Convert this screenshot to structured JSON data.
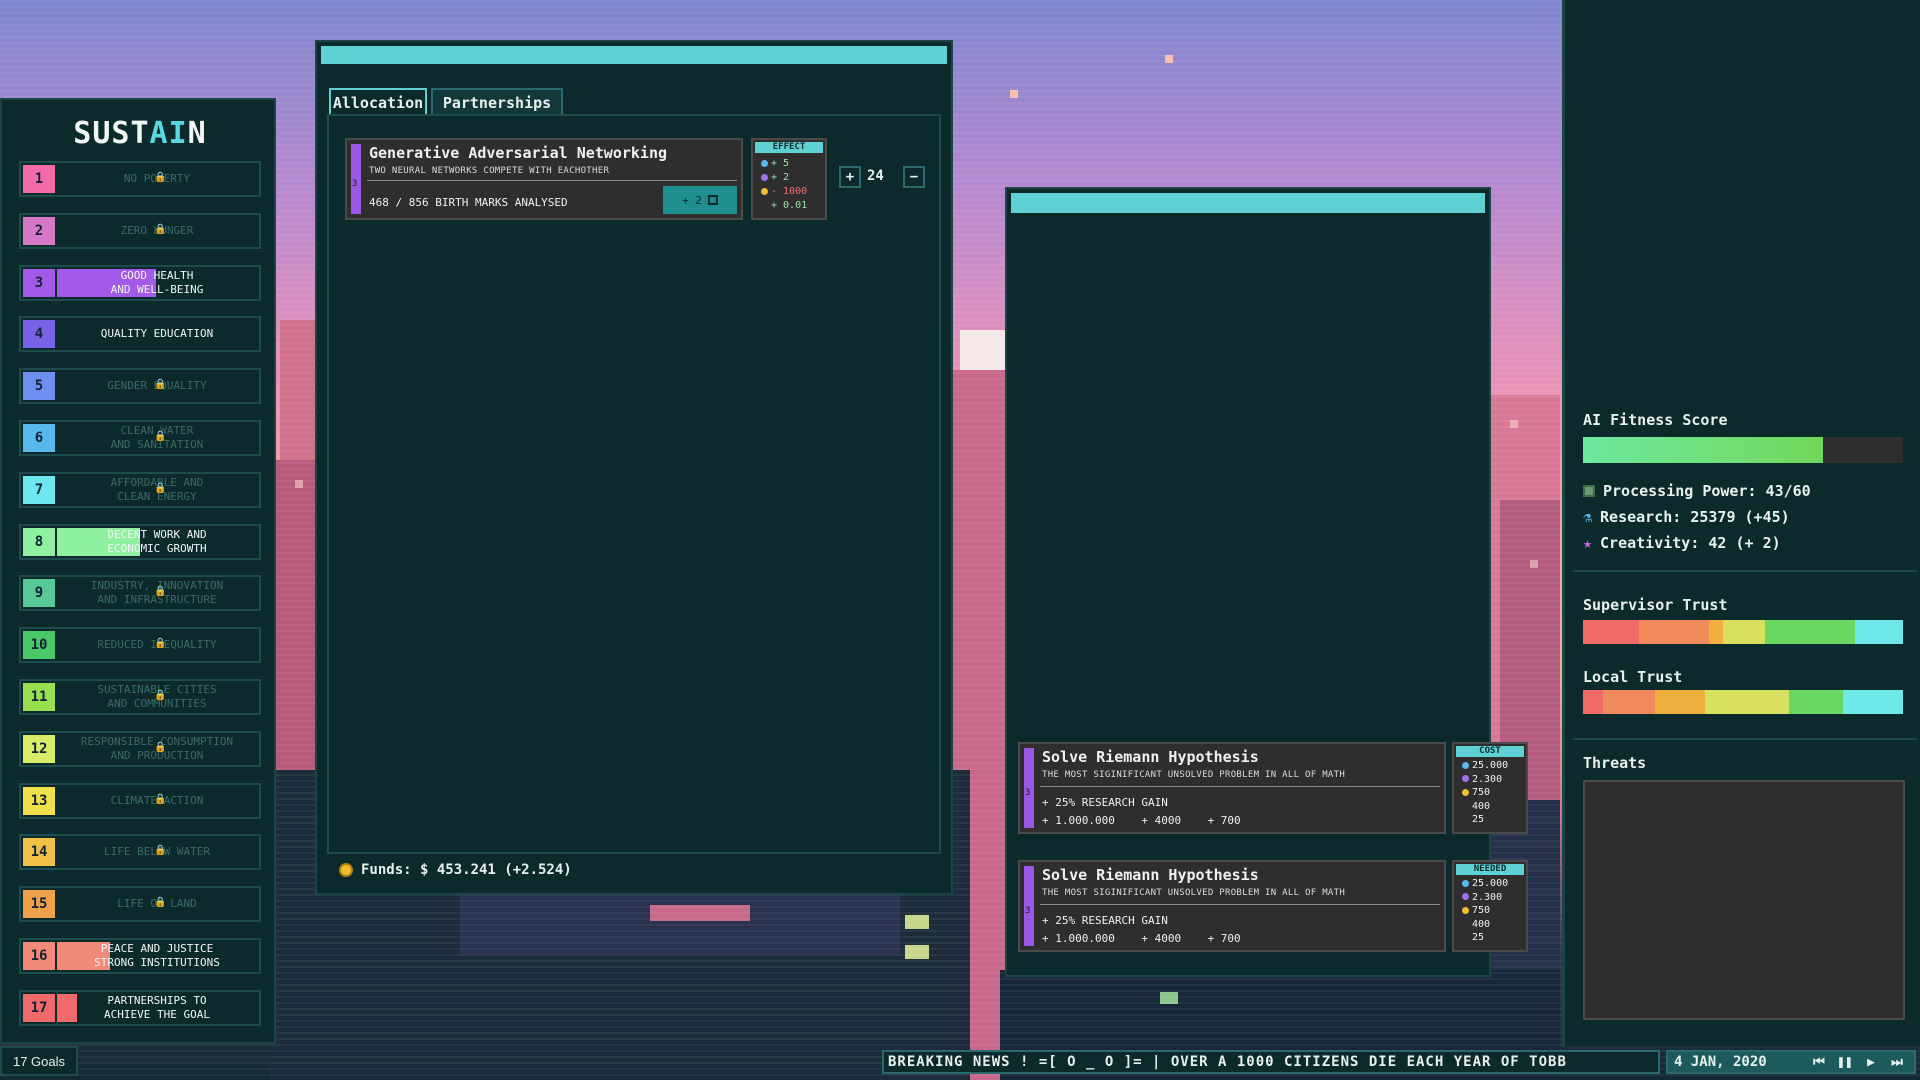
{
  "app": {
    "logo_pre": "SUST",
    "logo_hl": "AI",
    "logo_post": "N",
    "accent": "#5fd0d4"
  },
  "goals": [
    {
      "num": "1",
      "label": "NO POVERTY",
      "color": "#f26aa8",
      "locked": true,
      "progress": 0
    },
    {
      "num": "2",
      "label": "ZERO HUNGER",
      "color": "#d878c8",
      "locked": true,
      "progress": 0
    },
    {
      "num": "3",
      "label": "GOOD HEALTH\nAND WELL-BEING",
      "color": "#a35ae8",
      "locked": false,
      "progress": 0.49
    },
    {
      "num": "4",
      "label": "QUALITY EDUCATION",
      "color": "#7a62e6",
      "locked": false,
      "progress": 0
    },
    {
      "num": "5",
      "label": "GENDER EQUALITY",
      "color": "#6e8ef0",
      "locked": true,
      "progress": 0
    },
    {
      "num": "6",
      "label": "CLEAN WATER\nAND SANITATION",
      "color": "#58b8ee",
      "locked": true,
      "progress": 0
    },
    {
      "num": "7",
      "label": "AFFORDABLE AND\nCLEAN ENERGY",
      "color": "#6ee8f0",
      "locked": true,
      "progress": 0
    },
    {
      "num": "8",
      "label": "DECENT WORK AND\nECONOMIC GROWTH",
      "color": "#8ef0a0",
      "locked": false,
      "progress": 0.41
    },
    {
      "num": "9",
      "label": "INDUSTRY, INNOVATION\nAND INFRASTRUCTURE",
      "color": "#58c894",
      "locked": true,
      "progress": 0
    },
    {
      "num": "10",
      "label": "REDUCED INEQUALITY",
      "color": "#4ac868",
      "locked": true,
      "progress": 0
    },
    {
      "num": "11",
      "label": "SUSTAINABLE CITIES\nAND COMMUNITIES",
      "color": "#98e050",
      "locked": true,
      "progress": 0
    },
    {
      "num": "12",
      "label": "RESPONSIBLE CONSUMPTION\nAND PRODUCTION",
      "color": "#d8ec68",
      "locked": true,
      "progress": 0
    },
    {
      "num": "13",
      "label": "CLIMATE ACTION",
      "color": "#f0e04a",
      "locked": true,
      "progress": 0
    },
    {
      "num": "14",
      "label": "LIFE BELOW WATER",
      "color": "#f2c048",
      "locked": true,
      "progress": 0
    },
    {
      "num": "15",
      "label": "LIFE ON LAND",
      "color": "#f0a048",
      "locked": true,
      "progress": 0
    },
    {
      "num": "16",
      "label": "PEACE AND JUSTICE\nSTRONG INSTITUTIONS",
      "color": "#f28a7a",
      "locked": false,
      "progress": 0.26
    },
    {
      "num": "17",
      "label": "PARTNERSHIPS TO\nACHIEVE THE GOAL",
      "color": "#f06a6a",
      "locked": false,
      "progress": 0.1
    }
  ],
  "goals_count": "17 Goals",
  "main": {
    "tabs": [
      "Allocation",
      "Partnerships"
    ],
    "project": {
      "level": "3",
      "title": "Generative Adversarial Networking",
      "subtitle": "TWO NEURAL NETWORKS COMPETE WITH EACHOTHER",
      "progress_text": "468 / 856 BIRTH MARKS ANALYSED",
      "boost": "+ 2",
      "effect_head": "EFFECT",
      "effects": [
        "+ 5",
        "+ 2",
        "- 1000",
        "+ 0.01"
      ],
      "allocated": "24",
      "plus": "+",
      "minus": "−"
    },
    "funds": "Funds: $ 453.241 (+2.524)"
  },
  "secondary": {
    "cards": [
      {
        "level": "3",
        "title": "Solve Riemann Hypothesis",
        "subtitle": "THE MOST SIGINIFICANT UNSOLVED PROBLEM IN ALL OF MATH",
        "gain": "+ 25% RESEARCH GAIN",
        "rewards": "+ 1.000.000    + 4000    + 700",
        "box_head": "COST",
        "box_values": [
          "25.000",
          "2.300",
          "750",
          "400",
          "25"
        ]
      },
      {
        "level": "3",
        "title": "Solve Riemann Hypothesis",
        "subtitle": "THE MOST SIGINIFICANT UNSOLVED PROBLEM IN ALL OF MATH",
        "gain": "+ 25% RESEARCH GAIN",
        "rewards": "+ 1.000.000    + 4000    + 700",
        "box_head": "NEEDED",
        "box_values": [
          "25.000",
          "2.300",
          "750",
          "400",
          "25"
        ]
      }
    ]
  },
  "right": {
    "fitness_label": "AI Fitness Score",
    "fitness_value": 0.75,
    "processing": "Processing Power: 43/60",
    "research": "Research: 25379 (+45)",
    "creativity": "Creativity: 42 (+ 2)",
    "supervisor_label": "Supervisor Trust",
    "local_label": "Local Trust",
    "threats_label": "Threats"
  },
  "bottom": {
    "ticker": "BREAKING NEWS !  =[ O _ O ]= | OVER A 1000 CITIZENS DIE EACH YEAR OF TOBB",
    "date": "4 JAN, 2020",
    "controls": [
      "⏮",
      "❚❚",
      "▶",
      "⏭"
    ]
  },
  "icons": [
    "lock-icon",
    "chip-icon",
    "flask-icon",
    "star-icon",
    "coin-icon"
  ]
}
